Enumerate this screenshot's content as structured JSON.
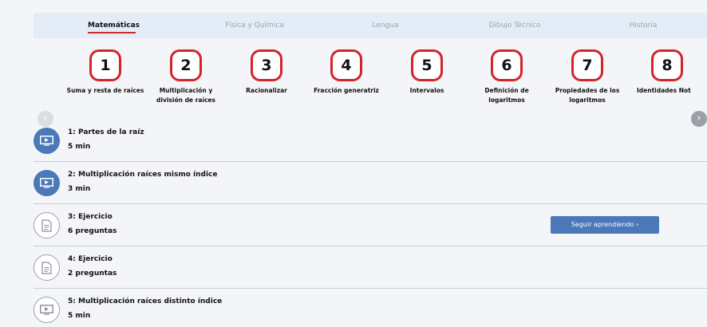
{
  "tabs": [
    {
      "label": "Matemáticas",
      "active": true
    },
    {
      "label": "Física y Química",
      "active": false
    },
    {
      "label": "Lengua",
      "active": false
    },
    {
      "label": "Dibujo Técnico",
      "active": false
    },
    {
      "label": "Historia",
      "active": false
    }
  ],
  "topics": [
    {
      "number": "1",
      "label": "Suma y resta de raíces"
    },
    {
      "number": "2",
      "label": "Multiplicación y\ndivisión de raíces"
    },
    {
      "number": "3",
      "label": "Racionalizar"
    },
    {
      "number": "4",
      "label": "Fracción generatriz"
    },
    {
      "number": "5",
      "label": "Intervalos"
    },
    {
      "number": "6",
      "label": "Definición de\nlogaritmos"
    },
    {
      "number": "7",
      "label": "Propiedades de los\nlogaritmos"
    },
    {
      "number": "8",
      "label": "Identidades Not"
    }
  ],
  "carousel": {
    "prev_icon": "chevron-left-icon",
    "next_icon": "chevron-right-icon"
  },
  "lessons": [
    {
      "title": "1: Partes de la raíz",
      "meta": "5 min",
      "icon": "video-icon"
    },
    {
      "title": "2: Multiplicación raíces mismo índice",
      "meta": "3 min",
      "icon": "video-icon"
    },
    {
      "title": "3: Ejercicio",
      "meta": "6 preguntas",
      "icon": "document-icon"
    },
    {
      "title": "4: Ejercicio",
      "meta": "2 preguntas",
      "icon": "document-icon"
    },
    {
      "title": "5: Multiplicación raíces distinto índice",
      "meta": "5 min",
      "icon": "video-outline-icon"
    }
  ],
  "continue_button": {
    "label": "Seguir aprendiendo ›"
  },
  "colors": {
    "accent_red": "#d0262b",
    "primary_blue": "#4a78b8",
    "tab_bar_bg": "#e4edf7"
  }
}
